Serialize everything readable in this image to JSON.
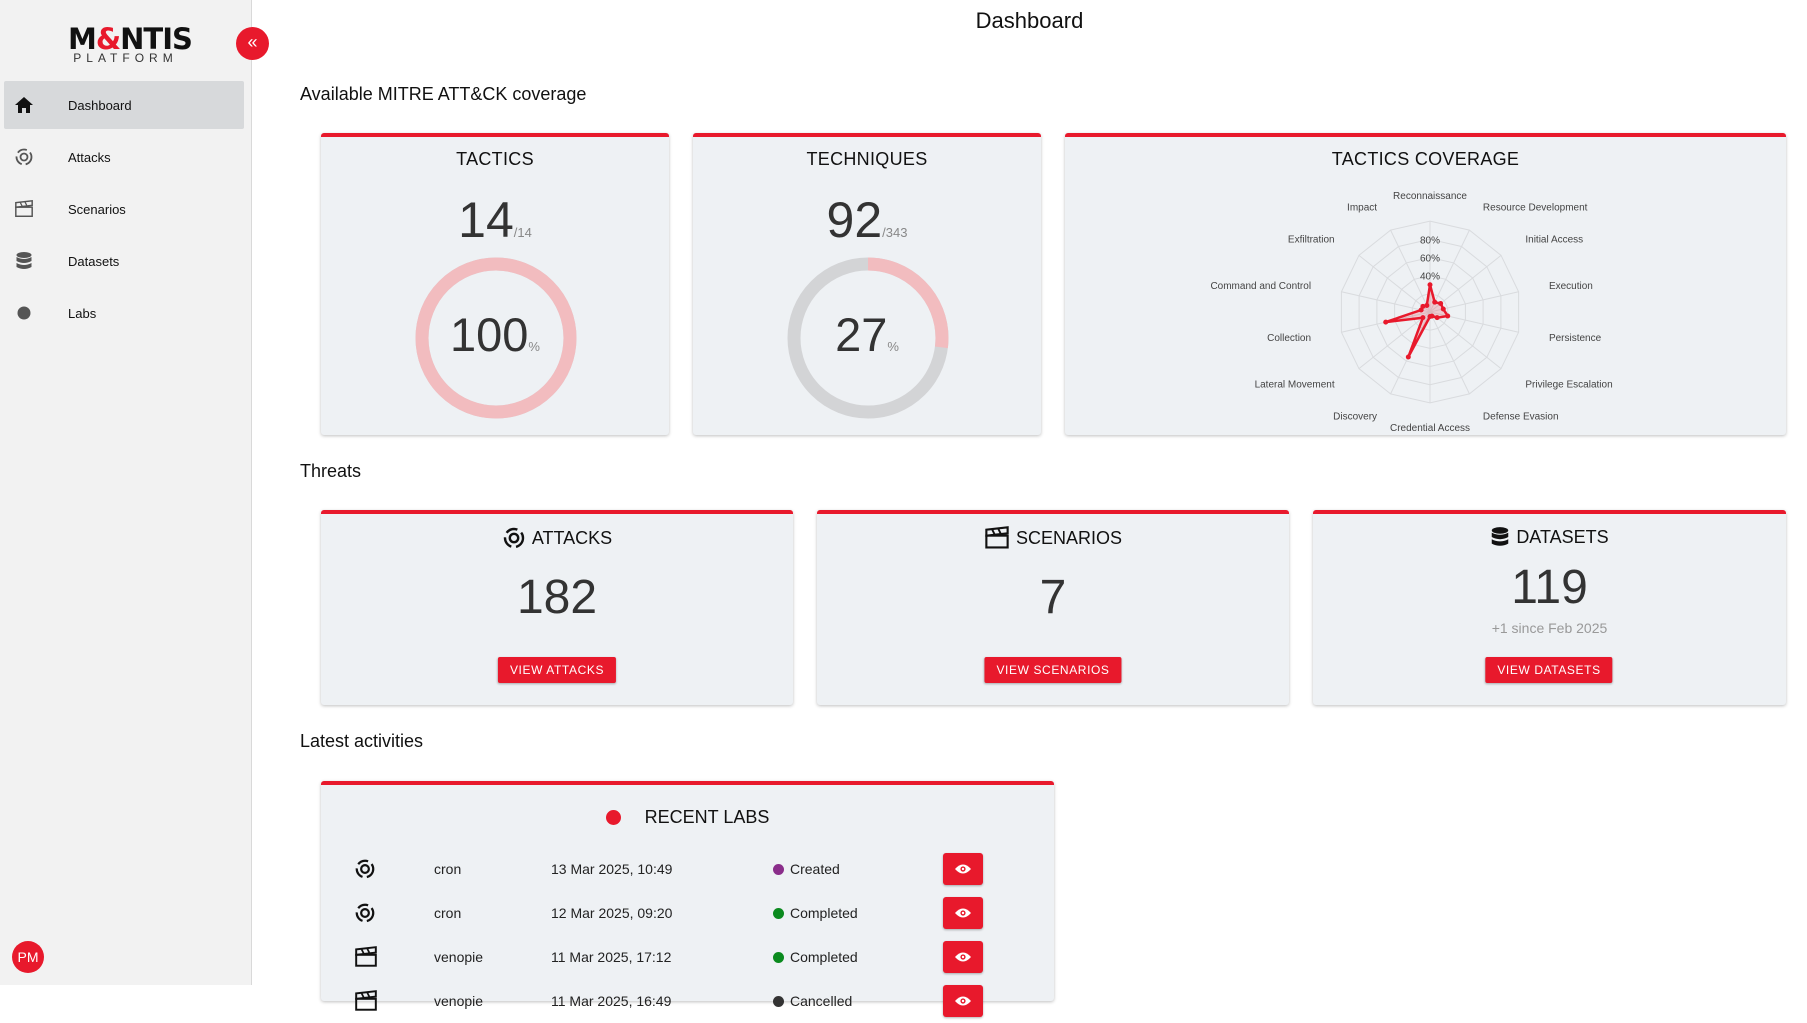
{
  "app": {
    "logo_main_left": "M",
    "logo_main_amp": "&",
    "logo_main_right": "NTIS",
    "logo_sub": "PLATFORM",
    "collapse_glyph": "«",
    "user_initials": "PM"
  },
  "sidebar": {
    "items": [
      {
        "label": "Dashboard",
        "icon": "home-icon",
        "active": true
      },
      {
        "label": "Attacks",
        "icon": "attack-icon"
      },
      {
        "label": "Scenarios",
        "icon": "clapperboard-icon"
      },
      {
        "label": "Datasets",
        "icon": "database-icon"
      },
      {
        "label": "Labs",
        "icon": "circle-icon"
      }
    ]
  },
  "page": {
    "title": "Dashboard"
  },
  "coverage": {
    "section_title": "Available MITRE ATT&CK coverage",
    "tactics": {
      "title": "TACTICS",
      "count": "14",
      "total": "/14",
      "percent": "100",
      "percent_unit": "%",
      "percent_value": 100
    },
    "techniques": {
      "title": "TECHNIQUES",
      "count": "92",
      "total": "/343",
      "percent": "27",
      "percent_unit": "%",
      "percent_value": 27
    },
    "tactics_coverage": {
      "title": "TACTICS COVERAGE"
    }
  },
  "chart_data": {
    "type": "radar",
    "title": "TACTICS COVERAGE",
    "categories": [
      "Reconnaissance",
      "Resource Development",
      "Initial Access",
      "Execution",
      "Persistence",
      "Privilege Escalation",
      "Defense Evasion",
      "Credential Access",
      "Discovery",
      "Lateral Movement",
      "Collection",
      "Command and Control",
      "Exfiltration",
      "Impact"
    ],
    "values": [
      30,
      12,
      15,
      15,
      20,
      10,
      5,
      5,
      55,
      10,
      50,
      10,
      10,
      8
    ],
    "range": [
      0,
      100
    ],
    "tick_labels": [
      "40%",
      "60%",
      "80%"
    ],
    "color": "#e8192c"
  },
  "threats": {
    "section_title": "Threats",
    "attacks": {
      "title": "ATTACKS",
      "count": "182",
      "button": "VIEW ATTACKS"
    },
    "scenarios": {
      "title": "SCENARIOS",
      "count": "7",
      "button": "VIEW SCENARIOS"
    },
    "datasets": {
      "title": "DATASETS",
      "count": "119",
      "sub": "+1 since Feb 2025",
      "button": "VIEW DATASETS"
    }
  },
  "activities": {
    "section_title": "Latest activities",
    "recent_labs": {
      "title": "RECENT LABS",
      "rows": [
        {
          "icon": "attack-icon",
          "name": "cron",
          "date": "13 Mar 2025, 10:49",
          "status": "Created",
          "status_color": "#8a2d8a"
        },
        {
          "icon": "attack-icon",
          "name": "cron",
          "date": "12 Mar 2025, 09:20",
          "status": "Completed",
          "status_color": "#0a8a1e"
        },
        {
          "icon": "clapperboard-icon",
          "name": "venopie",
          "date": "11 Mar 2025, 17:12",
          "status": "Completed",
          "status_color": "#0a8a1e"
        },
        {
          "icon": "clapperboard-icon",
          "name": "venopie",
          "date": "11 Mar 2025, 16:49",
          "status": "Cancelled",
          "status_color": "#333333"
        }
      ]
    }
  }
}
